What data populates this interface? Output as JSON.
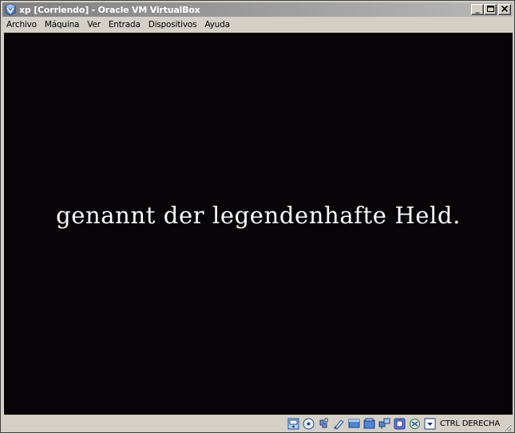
{
  "window": {
    "title": "xp [Corriendo] - Oracle VM VirtualBox",
    "controls": {
      "minimize": "_",
      "maximize": "□",
      "close": "×"
    }
  },
  "menu": {
    "items": [
      "Archivo",
      "Máquina",
      "Ver",
      "Entrada",
      "Dispositivos",
      "Ayuda"
    ]
  },
  "guest": {
    "text": "genannt der legendenhafte Held.",
    "background": "#070307",
    "text_color": "#ffffff"
  },
  "statusbar": {
    "icons": [
      "hard-disk-icon",
      "optical-drive-icon",
      "usb-icon",
      "shared-folders-icon",
      "display-icon",
      "video-capture-icon",
      "network-icon",
      "virtualization-icon",
      "mouse-integration-icon",
      "keyboard-capture-icon"
    ],
    "host_key": "CTRL DERECHA"
  },
  "colors": {
    "frame": "#d4d0c8",
    "titlebar_inactive": "#808080"
  }
}
